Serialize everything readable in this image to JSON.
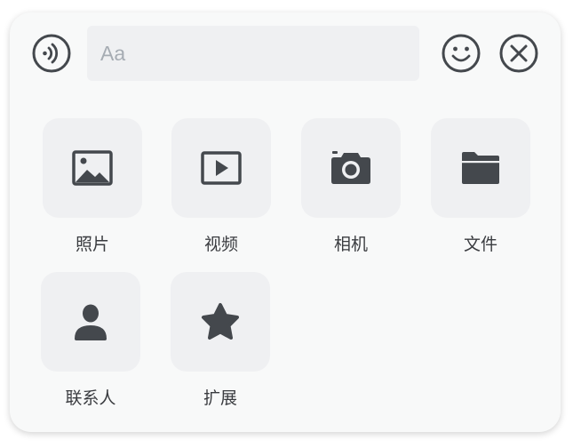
{
  "composer": {
    "input_placeholder": "Aa",
    "voice_icon": "voice-icon",
    "emoji_icon": "emoji-icon",
    "close_icon": "close-icon"
  },
  "actions": [
    {
      "label": "照片",
      "icon": "image-icon"
    },
    {
      "label": "视频",
      "icon": "video-icon"
    },
    {
      "label": "相机",
      "icon": "camera-icon"
    },
    {
      "label": "文件",
      "icon": "folder-icon"
    },
    {
      "label": "联系人",
      "icon": "person-icon"
    },
    {
      "label": "扩展",
      "icon": "star-icon"
    }
  ],
  "colors": {
    "icon": "#44484d",
    "tile": "#eff0f2",
    "panel": "#f8f9f9"
  }
}
